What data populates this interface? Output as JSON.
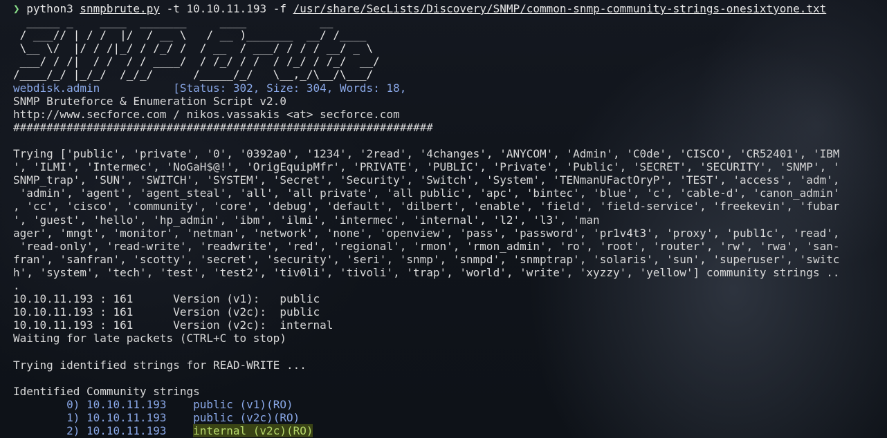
{
  "prompt": {
    "arrow": "❯",
    "cmd": "python3",
    "script": "snmpbrute.py",
    "args": " -t 10.10.11.193 -f ",
    "wordlist": "/usr/share/SecLists/Discovery/SNMP/common-snmp-community-strings-onesixtyone.txt"
  },
  "banner": [
    "  _____ _    ____  _______     ____           __",
    " / ___// | / /  |/  / __ \\   / __ )_______  __/ /____",
    " \\__ \\/  |/ / /|_/ / /_/ /  / __  / ___/ / / / __/ _ \\",
    " ___/ / /|  / /  / / ____/  / /_/ / /  / /_/ / /_/  __/",
    "/____/_/ |_/_/  /_/_/      /_____/_/   \\__,_/\\__/\\___/"
  ],
  "webdisk": {
    "name": "webdisk.admin",
    "status": "[Status: 302, Size: 304, Words: 18,"
  },
  "header": [
    "SNMP Bruteforce & Enumeration Script v2.0",
    "http://www.secforce.com / nikos.vassakis <at> secforce.com",
    "###############################################################"
  ],
  "trying": [
    "Trying ['public', 'private', '0', '0392a0', '1234', '2read', '4changes', 'ANYCOM', 'Admin', 'C0de', 'CISCO', 'CR52401', 'IBM",
    "', 'ILMI', 'Intermec', 'NoGaH$@!', 'OrigEquipMfr', 'PRIVATE', 'PUBLIC', 'Private', 'Public', 'SECRET', 'SECURITY', 'SNMP', '",
    "SNMP_trap', 'SUN', 'SWITCH', 'SYSTEM', 'Secret', 'Security', 'Switch', 'System', 'TENmanUFactOryP', 'TEST', 'access', 'adm',",
    " 'admin', 'agent', 'agent_steal', 'all', 'all private', 'all public', 'apc', 'bintec', 'blue', 'c', 'cable-d', 'canon_admin'",
    ", 'cc', 'cisco', 'community', 'core', 'debug', 'default', 'dilbert', 'enable', 'field', 'field-service', 'freekevin', 'fubar",
    "', 'guest', 'hello', 'hp_admin', 'ibm', 'ilmi', 'intermec', 'internal', 'l2', 'l3', 'man",
    "ager', 'mngt', 'monitor', 'netman', 'network', 'none', 'openview', 'pass', 'password', 'pr1v4t3', 'proxy', 'publ1c', 'read',",
    " 'read-only', 'read-write', 'readwrite', 'red', 'regional', 'rmon', 'rmon_admin', 'ro', 'root', 'router', 'rw', 'rwa', 'san-",
    "fran', 'sanfran', 'scotty', 'secret', 'security', 'seri', 'snmp', 'snmpd', 'snmptrap', 'solaris', 'sun', 'superuser', 'switc",
    "h', 'system', 'tech', 'test', 'test2', 'tiv0li', 'tivoli', 'trap', 'world', 'write', 'xyzzy', 'yellow'] community strings ..",
    "."
  ],
  "results": [
    "10.10.11.193 : 161      Version (v1):   public",
    "10.10.11.193 : 161      Version (v2c):  public",
    "10.10.11.193 : 161      Version (v2c):  internal"
  ],
  "waiting": "Waiting for late packets (CTRL+C to stop)",
  "trying_rw": "Trying identified strings for READ-WRITE ...",
  "identified_title": "Identified Community strings",
  "identified": [
    {
      "index": "        0) 10.10.11.193",
      "value": "public (v1)(RO)",
      "highlight": false
    },
    {
      "index": "        1) 10.10.11.193",
      "value": "public (v2c)(RO)",
      "highlight": false
    },
    {
      "index": "        2) 10.10.11.193",
      "value": "internal (v2c)(RO)",
      "highlight": true
    }
  ],
  "colors": {
    "prompt_arrow": "#8be28b",
    "blue_text": "#8aa8e8",
    "highlight_bg": "#5f6e14",
    "highlight_fg": "#b6d86a"
  }
}
